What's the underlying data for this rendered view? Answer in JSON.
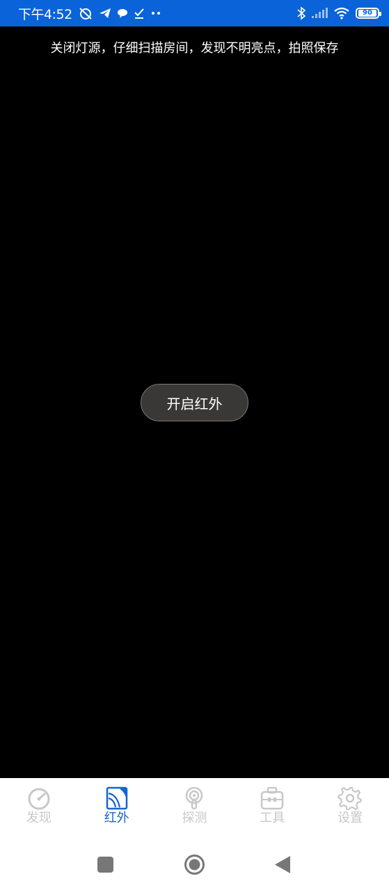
{
  "status_bar": {
    "time": "下午4:52",
    "battery": "90",
    "icons_left": [
      "alarm-off-icon",
      "telegram-icon",
      "chat-icon",
      "task-done-icon",
      "more-dots-icon"
    ],
    "icons_right": [
      "bluetooth-icon",
      "signal-icon",
      "wifi-icon",
      "battery-icon"
    ],
    "background_color": "#0a63d8"
  },
  "main": {
    "hint": "关闭灯源，仔细扫描房间，发现不明亮点，拍照保存",
    "ir_button_label": "开启红外"
  },
  "bottom_nav": {
    "active_color": "#1763d3",
    "inactive_color": "#c8c8c8",
    "items": [
      {
        "label": "发现",
        "icon": "radar-gauge-icon",
        "active": false
      },
      {
        "label": "红外",
        "icon": "infrared-signal-icon",
        "active": true
      },
      {
        "label": "探测",
        "icon": "detector-icon",
        "active": false
      },
      {
        "label": "工具",
        "icon": "toolbox-icon",
        "active": false
      },
      {
        "label": "设置",
        "icon": "gear-icon",
        "active": false
      }
    ]
  },
  "system_nav": {
    "buttons": [
      "recents-square-icon",
      "home-circle-icon",
      "back-triangle-icon"
    ]
  }
}
